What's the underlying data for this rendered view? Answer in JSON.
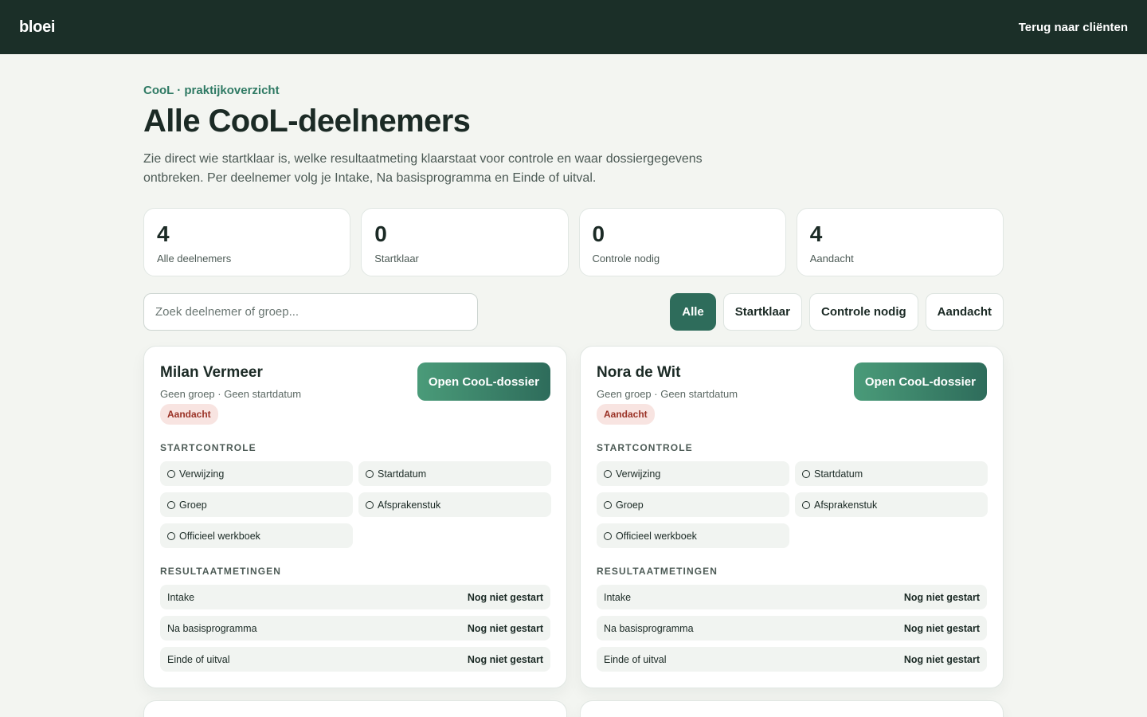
{
  "header": {
    "brand": "bloei",
    "back_link": "Terug naar cliënten"
  },
  "page": {
    "eyebrow": "CooL · praktijkoverzicht",
    "title": "Alle CooL-deelnemers",
    "intro": "Zie direct wie startklaar is, welke resultaatmeting klaarstaat voor controle en waar dossiergegevens ontbreken. Per deelnemer volg je Intake, Na basisprogramma en Einde of uitval."
  },
  "stats": [
    {
      "value": "4",
      "label": "Alle deelnemers"
    },
    {
      "value": "0",
      "label": "Startklaar"
    },
    {
      "value": "0",
      "label": "Controle nodig"
    },
    {
      "value": "4",
      "label": "Aandacht"
    }
  ],
  "search": {
    "placeholder": "Zoek deelnemer of groep..."
  },
  "filters": [
    {
      "label": "Alle",
      "active": true
    },
    {
      "label": "Startklaar",
      "active": false
    },
    {
      "label": "Controle nodig",
      "active": false
    },
    {
      "label": "Aandacht",
      "active": false
    }
  ],
  "labels": {
    "startcontrole": "STARTCONTROLE",
    "resultaatmetingen": "RESULTAATMETINGEN"
  },
  "participants": [
    {
      "name": "Milan Vermeer",
      "meta": "Geen groep · Geen startdatum",
      "badge": "Aandacht",
      "open_label": "Open CooL-dossier",
      "checks": [
        "Verwijzing",
        "Startdatum",
        "Groep",
        "Afsprakenstuk",
        "Officieel werkboek"
      ],
      "metings": [
        {
          "label": "Intake",
          "status": "Nog niet gestart"
        },
        {
          "label": "Na basisprogramma",
          "status": "Nog niet gestart"
        },
        {
          "label": "Einde of uitval",
          "status": "Nog niet gestart"
        }
      ]
    },
    {
      "name": "Nora de Wit",
      "meta": "Geen groep · Geen startdatum",
      "badge": "Aandacht",
      "open_label": "Open CooL-dossier",
      "checks": [
        "Verwijzing",
        "Startdatum",
        "Groep",
        "Afsprakenstuk",
        "Officieel werkboek"
      ],
      "metings": [
        {
          "label": "Intake",
          "status": "Nog niet gestart"
        },
        {
          "label": "Na basisprogramma",
          "status": "Nog niet gestart"
        },
        {
          "label": "Einde of uitval",
          "status": "Nog niet gestart"
        }
      ]
    }
  ],
  "colors": {
    "header_bg": "#1b2f28",
    "accent": "#2e6c5b",
    "eyebrow": "#2f7a64",
    "badge_bg": "#f8e4e1",
    "badge_text": "#9a3226"
  }
}
